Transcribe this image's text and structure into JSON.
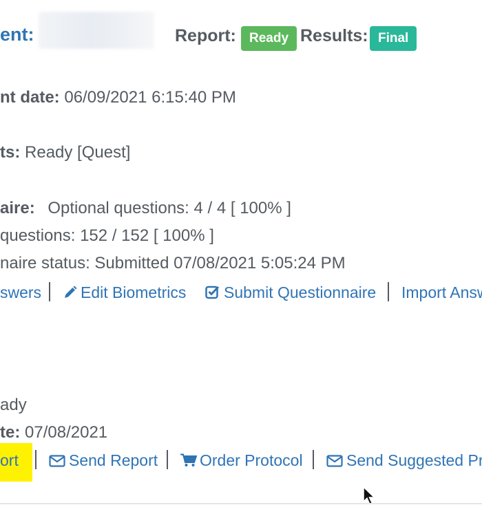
{
  "header": {
    "patient_label_partial": "ent:",
    "report_label": "Report:",
    "report_status": "Ready",
    "results_label": "Results:",
    "results_status": "Final",
    "status_colors": {
      "ready": "#5cb85c",
      "final": "#2ab89a"
    }
  },
  "details": {
    "date_label_partial": "nt date:",
    "date_value": "06/09/2021 6:15:40 PM",
    "status_label_partial": "ts:",
    "status_value": "Ready [Quest]"
  },
  "questionnaire": {
    "label_partial": "aire:",
    "optional_questions": "Optional questions: 4 / 4 [ 100% ]",
    "required_questions_partial": "questions: 152 / 152 [ 100% ]",
    "status_line_partial": "naire status: Submitted 07/08/2021 5:05:24 PM",
    "actions": {
      "answers_partial": "swers",
      "edit_biometrics": "Edit Biometrics",
      "submit_questionnaire": "Submit Questionnaire",
      "import_answers_partial": "Import Answ"
    }
  },
  "report": {
    "status_partial": "ady",
    "date_partial_label": "te:",
    "date_value": "07/08/2021",
    "actions": {
      "view_report_partial": "ort",
      "send_report": "Send Report",
      "order_protocol": "Order Protocol",
      "send_suggested_partial": "Send Suggested Pro"
    }
  },
  "icons": {
    "edit": "pencil-icon",
    "submit": "check-square-icon",
    "send": "envelope-icon",
    "order": "cart-icon",
    "cursor": "mouse-pointer-icon"
  },
  "colors": {
    "link": "#2f74b5",
    "text": "#555b61",
    "highlight": "#fff200"
  }
}
